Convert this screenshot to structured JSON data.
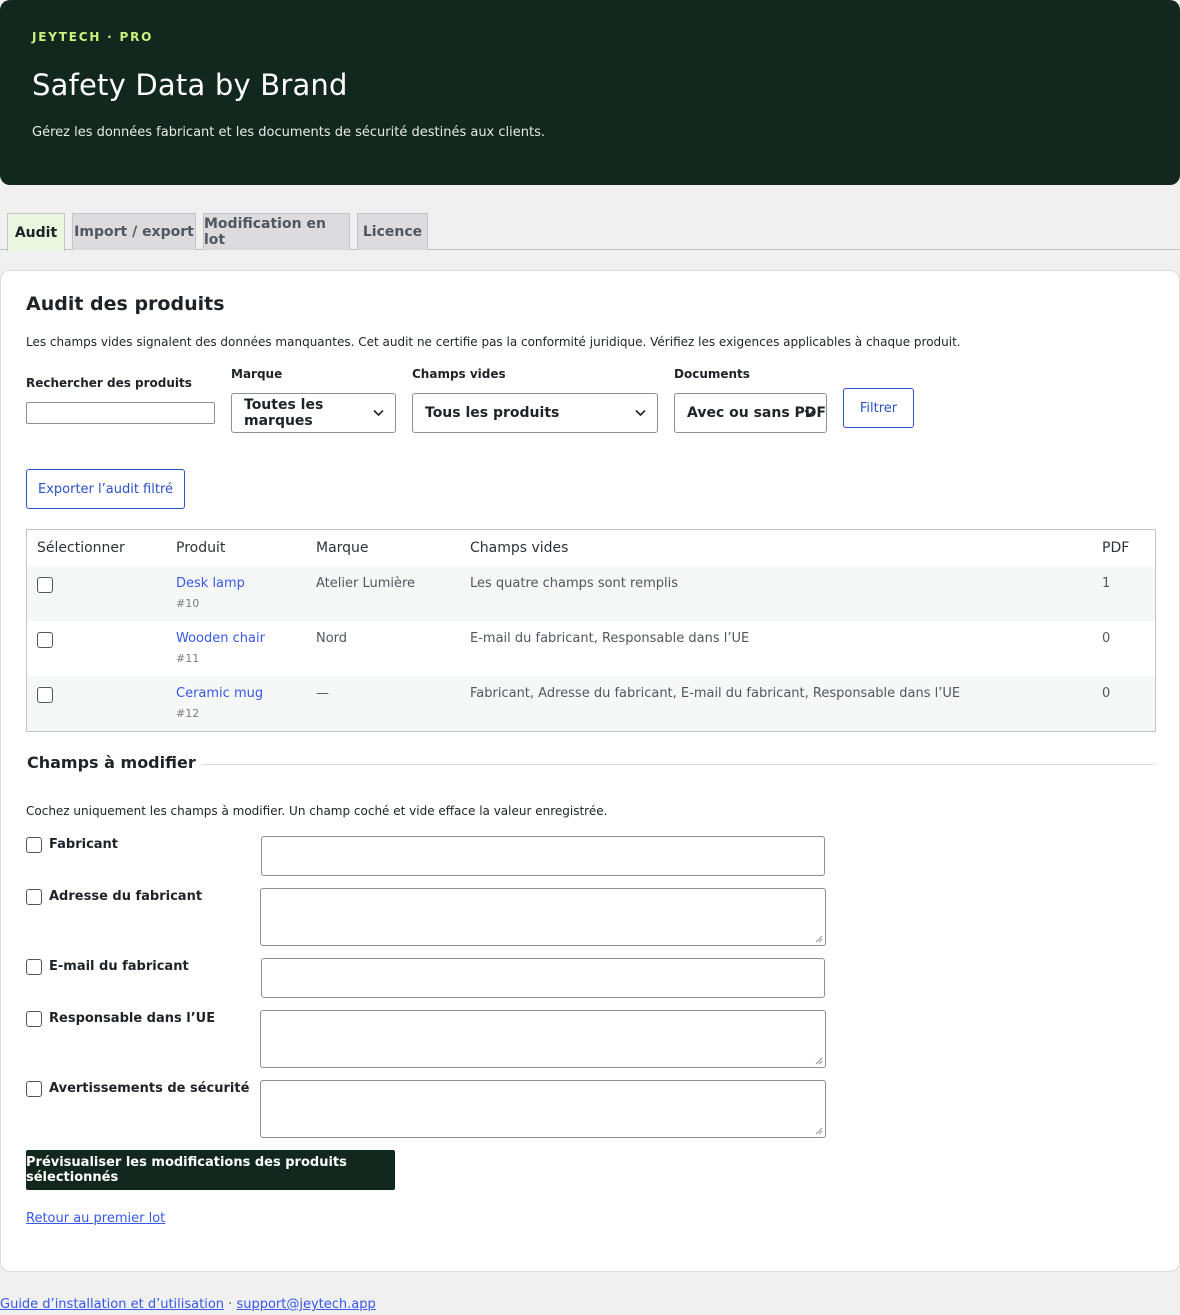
{
  "header": {
    "eyebrow": "JEYTECH · PRO",
    "title": "Safety Data by Brand",
    "subtitle": "Gérez les données fabricant et les documents de sécurité destinés aux clients."
  },
  "tabs": [
    {
      "label": "Audit",
      "active": true
    },
    {
      "label": "Import / export",
      "active": false
    },
    {
      "label": "Modification en lot",
      "active": false
    },
    {
      "label": "Licence",
      "active": false
    }
  ],
  "audit": {
    "title": "Audit des produits",
    "note": "Les champs vides signalent des données manquantes. Cet audit ne certifie pas la conformité juridique. Vérifiez les exigences applicables à chaque produit.",
    "filters": {
      "search_label": "Rechercher des produits",
      "search_value": "",
      "brand_label": "Marque",
      "brand_value": "Toutes les marques",
      "empty_label": "Champs vides",
      "empty_value": "Tous les produits",
      "docs_label": "Documents",
      "docs_value": "Avec ou sans PDF",
      "filter_button": "Filtrer"
    },
    "export_button": "Exporter l’audit filtré",
    "table": {
      "headers": [
        "Sélectionner",
        "Produit",
        "Marque",
        "Champs vides",
        "PDF"
      ],
      "rows": [
        {
          "name": "Desk lamp",
          "id": "#10",
          "brand": "Atelier Lumière",
          "empty": "Les quatre champs sont remplis",
          "pdf": "1",
          "selected": false
        },
        {
          "name": "Wooden chair",
          "id": "#11",
          "brand": "Nord",
          "empty": "E-mail du fabricant, Responsable dans l’UE",
          "pdf": "0",
          "selected": false
        },
        {
          "name": "Ceramic mug",
          "id": "#12",
          "brand": "—",
          "empty": "Fabricant, Adresse du fabricant, E-mail du fabricant, Responsable dans l’UE",
          "pdf": "0",
          "selected": false
        }
      ]
    }
  },
  "modify": {
    "legend": "Champs à modifier",
    "note": "Cochez uniquement les champs à modifier. Un champ coché et vide efface la valeur enregistrée.",
    "fields": [
      {
        "label": "Fabricant",
        "value": ""
      },
      {
        "label": "Adresse du fabricant",
        "value": ""
      },
      {
        "label": "E-mail du fabricant",
        "value": ""
      },
      {
        "label": "Responsable dans l’UE",
        "value": ""
      },
      {
        "label": "Avertissements de sécurité",
        "value": ""
      }
    ],
    "preview_button": "Prévisualiser les modifications des produits sélectionnés",
    "back_link": "Retour au premier lot"
  },
  "footer": {
    "guide_link": "Guide d’installation et d’utilisation",
    "separator": " · ",
    "support_link": "support@jeytech.app"
  },
  "colors": {
    "brand_dark": "#12281f",
    "accent_green": "#cdf27a",
    "link_blue": "#3858e9",
    "active_tab": "#eaf6df"
  },
  "icons": {
    "select_arrow": "chevron-down-icon",
    "textarea_resize": "resize-grip-icon"
  }
}
